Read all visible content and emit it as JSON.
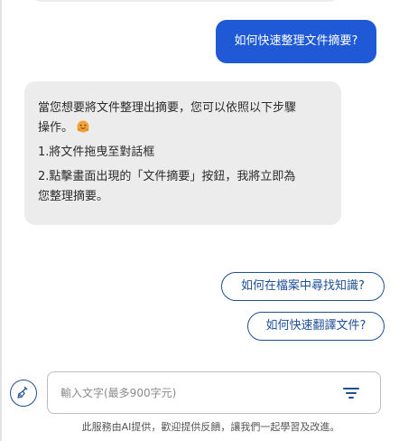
{
  "conversation": {
    "user_message": "如何快速整理文件摘要?",
    "bot_reply": {
      "line1": "當您想要將文件整理出摘要，您可以依照以下步驟",
      "line2": "操作。",
      "emoji": "hugging-face-emoji",
      "line3": "1.將文件拖曳至對話框",
      "line4": "2.點擊畫面出現的「文件摘要」按鈕，我將立即為",
      "line5": "您整理摘要。"
    }
  },
  "suggestions": [
    {
      "label": "如何在檔案中尋找知識?"
    },
    {
      "label": "如何快速翻譯文件?"
    }
  ],
  "composer": {
    "placeholder": "輸入文字(最多900字元)",
    "value": "",
    "clean_icon": "broom-icon",
    "filter_icon": "filter-lines-icon"
  },
  "footer": {
    "note": "此服務由AI提供，歡迎提供反饋，讓我們一起學習及改進。"
  },
  "colors": {
    "user_bubble": "#1f59d6",
    "bot_bubble": "#ececec",
    "accent": "#1e4f96",
    "emoji": "#f2a33a"
  }
}
